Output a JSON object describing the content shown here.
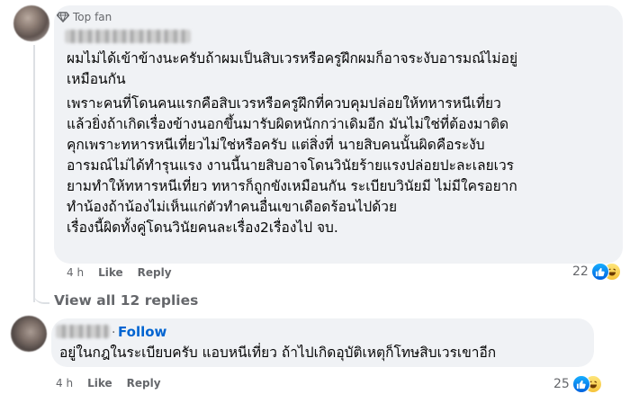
{
  "comment1": {
    "badge_label": "Top fan",
    "lines": [
      "ผมไม่ได้เข้าข้างนะครับถ้าผมเป็นสิบเวรหรือครูฝึกผมก็อาจระงับอารมณ์ไม่อยู่",
      "เหมือนกัน",
      "เพราะคนที่โดนคนแรกคือสิบเวรหรือครูฝึกที่ควบคุมปล่อยให้ทหารหนีเที่ยว",
      "แล้วยิ่งถ้าเกิดเรื่องข้างนอกขึ้นมารับผิดหนักกว่าเดิมอีก มันไม่ใช่ที่ต้องมาติด",
      "คุกเพราะทหารหนีเที่ยวไม่ใช่หรือครับ แต่สิ่งที่ นายสิบคนนั้นผิดคือระงับ",
      "อารมณ์ไม่ได้ทำรุนแรง งานนี้นายสิบอาจโดนวินัยร้ายแรงปล่อยปะละเลยเวร",
      "ยามทำให้ทหารหนีเที่ยว ทหารก็ถูกขังเหมือนกัน ระเบียบวินัยมี ไม่มีใครอยาก",
      "ทำน้องถ้าน้องไม่เห็นแก่ตัวทำคนอื่นเขาเดือดร้อนไปด้วย",
      "เรื่องนี้ผิดทั้งคู่โดนวินัยคนละเรื่อง2เรื่องไป จบ."
    ],
    "time": "4 h",
    "like_label": "Like",
    "reply_label": "Reply",
    "reaction_count": "22"
  },
  "view_all_label": "View all 12 replies",
  "comment2": {
    "follow_label": "Follow",
    "separator": "·",
    "text": "อยู่ในกฎในระเบียบครับ แอบหนีเที่ยว ถ้าไปเกิดอุบัติเหตุก็โทษสิบเวรเขาอีก",
    "time": "4 h",
    "like_label": "Like",
    "reply_label": "Reply",
    "reaction_count": "25"
  },
  "icons": [
    "top-fan-diamond-icon",
    "like-reaction-icon",
    "haha-reaction-icon"
  ],
  "colors": {
    "bubble": "#f0f2f5",
    "meta_text": "#65676b",
    "follow_blue": "#0064d1",
    "like_blue": "#0866ff"
  }
}
